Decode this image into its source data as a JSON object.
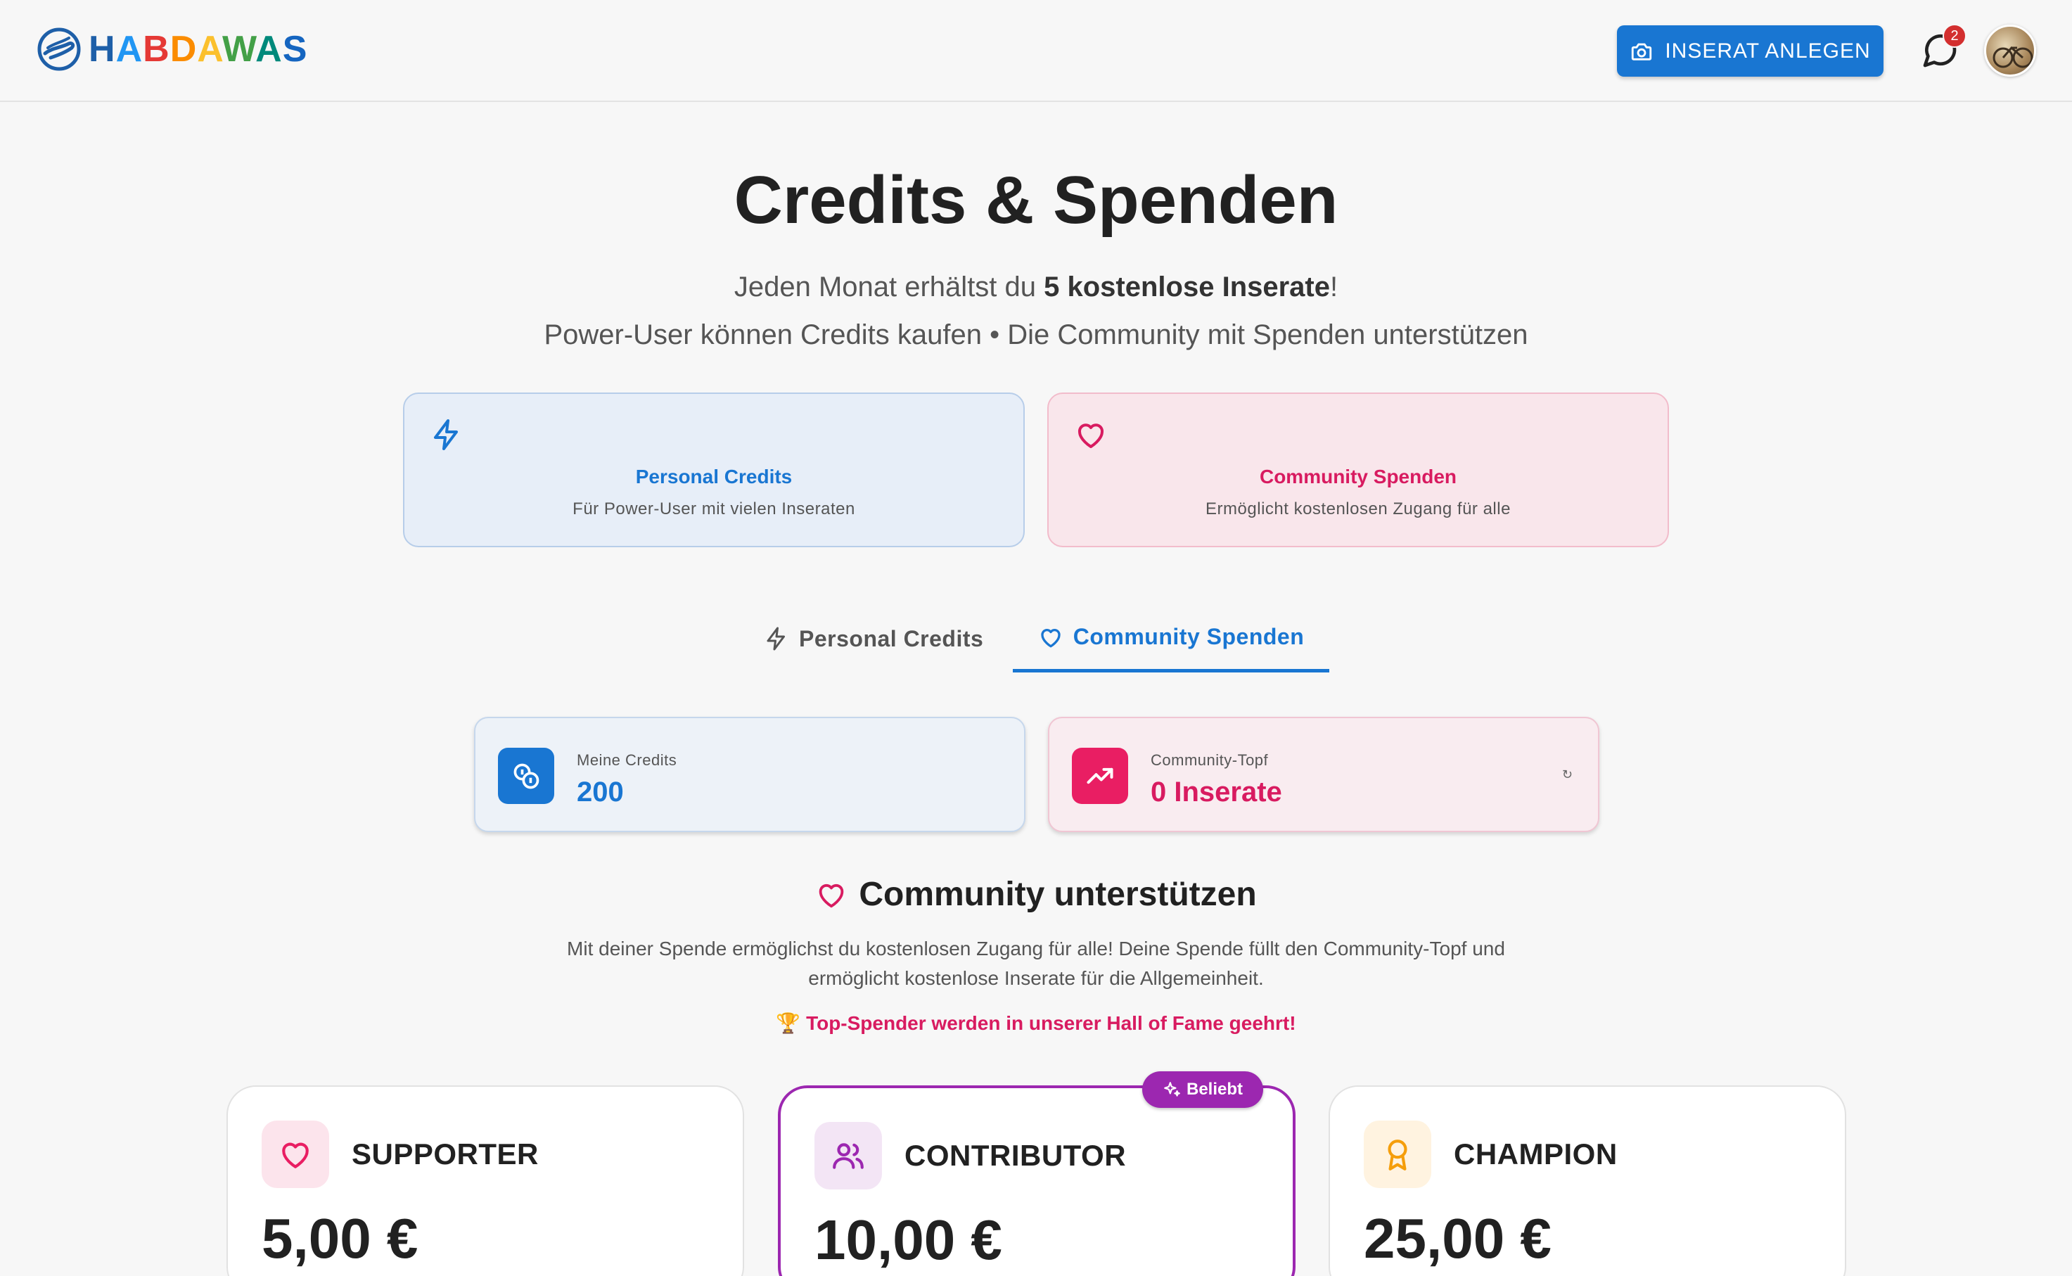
{
  "header": {
    "logo_letters": [
      {
        "char": "H",
        "color": "#1e5fa8"
      },
      {
        "char": "A",
        "color": "#2196f3"
      },
      {
        "char": "B",
        "color": "#e53935"
      },
      {
        "char": "D",
        "color": "#fb8c00"
      },
      {
        "char": "A",
        "color": "#fbc02d"
      },
      {
        "char": "W",
        "color": "#43a047"
      },
      {
        "char": "A",
        "color": "#00897b"
      },
      {
        "char": "S",
        "color": "#1565c0"
      }
    ],
    "cta_label": "INSERAT ANLEGEN",
    "cta_icon": "camera-icon",
    "chat_icon": "chat-bubble-icon",
    "notification_count": "2"
  },
  "hero": {
    "title": "Credits & Spenden",
    "sub1_prefix": "Jeden Monat erhältst du ",
    "sub1_bold": "5 kostenlose Inserate",
    "sub1_suffix": "!",
    "sub2": "Power-User können Credits kaufen • Die Community mit Spenden unterstützen"
  },
  "info_cards": {
    "personal": {
      "title": "Personal Credits",
      "desc": "Für Power-User mit vielen Inseraten",
      "icon": "lightning-icon"
    },
    "community": {
      "title": "Community Spenden",
      "desc": "Ermöglicht kostenlosen Zugang für alle",
      "icon": "heart-icon"
    }
  },
  "tabs": {
    "personal": "Personal Credits",
    "community": "Community Spenden",
    "active": "community"
  },
  "stats": {
    "credits": {
      "label": "Meine Credits",
      "value": "200"
    },
    "topf": {
      "label": "Community-Topf",
      "value": "0 Inserate",
      "refresh": "↻"
    }
  },
  "section": {
    "title": "Community unterstützen",
    "desc_line1": "Mit deiner Spende ermöglichst du kostenlosen Zugang für alle! Deine Spende füllt den Community-Topf und",
    "desc_line2": "ermöglicht kostenlose Inserate für die Allgemeinheit.",
    "hall_of_fame": "🏆 Top-Spender werden in unserer Hall of Fame geehrt!"
  },
  "tiers": [
    {
      "name": "SUPPORTER",
      "price": "5,00 €",
      "icon": "heart-icon"
    },
    {
      "name": "CONTRIBUTOR",
      "price": "10,00 €",
      "icon": "users-icon",
      "badge": "Beliebt"
    },
    {
      "name": "CHAMPION",
      "price": "25,00 €",
      "icon": "award-icon"
    }
  ],
  "colors": {
    "primary": "#1976d2",
    "pink": "#d81b60",
    "purple": "#9c27b0",
    "orange": "#f59e0b"
  }
}
